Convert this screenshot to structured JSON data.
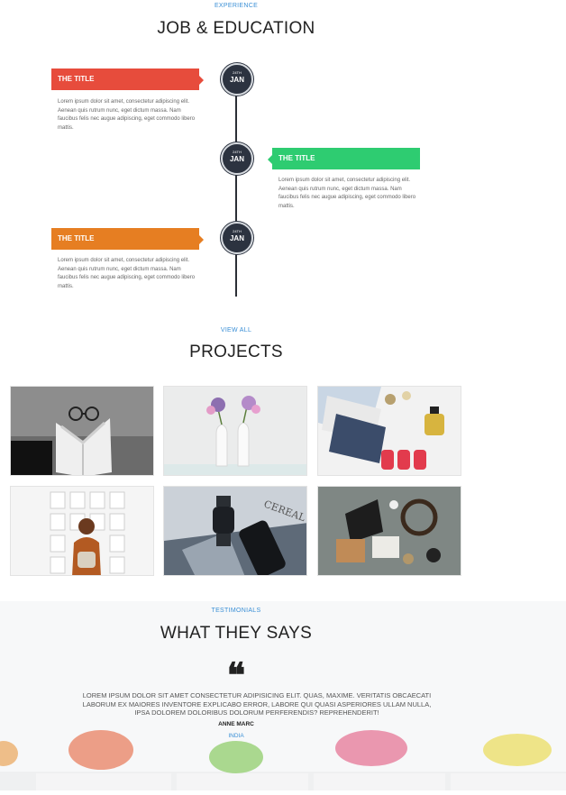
{
  "experience": {
    "eyebrow": "EXPERIENCE",
    "title": "JOB & EDUCATION",
    "items": [
      {
        "day": "24TH",
        "month": "JAN",
        "title": "THE TITLE",
        "color": "#e74c3c",
        "text": "Lorem ipsum dolor sit amet, consectetur adipiscing elit. Aenean quis rutrum nunc, eget dictum massa. Nam faucibus felis nec augue adipiscing, eget commodo libero mattis."
      },
      {
        "day": "24TH",
        "month": "JAN",
        "title": "THE TITLE",
        "color": "#2ecc71",
        "text": "Lorem ipsum dolor sit amet, consectetur adipiscing elit. Aenean quis rutrum nunc, eget dictum massa. Nam faucibus felis nec augue adipiscing, eget commodo libero mattis."
      },
      {
        "day": "24TH",
        "month": "JAN",
        "title": "THE TITLE",
        "color": "#e67e22",
        "text": "Lorem ipsum dolor sit amet, consectetur adipiscing elit. Aenean quis rutrum nunc, eget dictum massa. Nam faucibus felis nec augue adipiscing, eget commodo libero mattis."
      }
    ]
  },
  "projects": {
    "eyebrow": "VIEW ALL",
    "title": "PROJECTS",
    "images": [
      "open-book-glasses-image",
      "flowers-vases-image",
      "magazines-perfume-image",
      "gallery-visitor-image",
      "phone-watch-image",
      "flatlay-accessories-image"
    ]
  },
  "testimonials": {
    "eyebrow": "TESTIMONIALS",
    "title": "WHAT THEY SAYS",
    "quote_icon": "quote-icon",
    "text": "LOREM IPSUM DOLOR SIT AMET CONSECTETUR ADIPISICING ELIT. QUAS, MAXIME. VERITATIS OBCAECATI LABORUM EX MAIORES INVENTORE EXPLICABO ERROR, LABORE QUI QUASI ASPERIORES ULLAM NULLA, IPSA DOLOREM DOLORIBUS DOLORUM PERFERENDIS? REPREHENDERIT!",
    "name": "ANNE MARC",
    "location": "INDIA",
    "background_image": "succulent-pots-image"
  }
}
